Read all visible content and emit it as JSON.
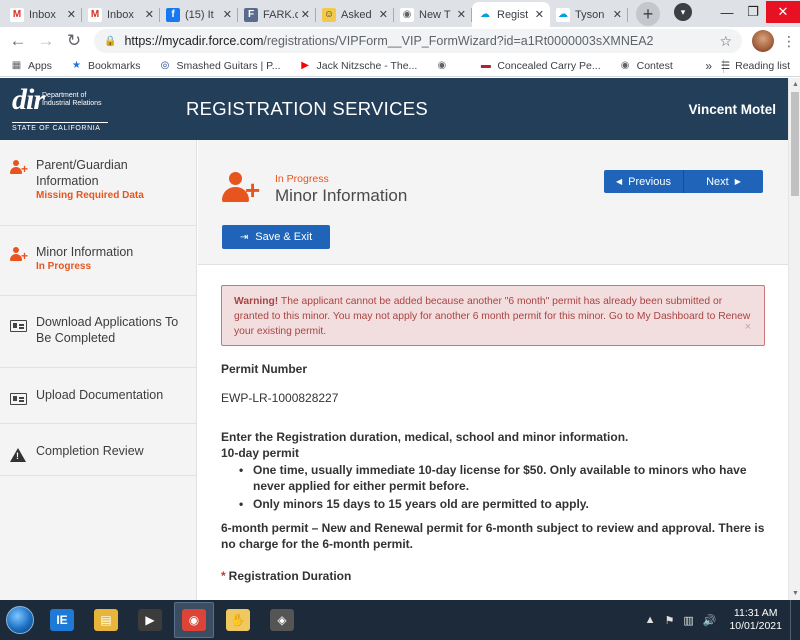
{
  "browser": {
    "tabs": [
      {
        "title": "Inbox",
        "icon": "M",
        "icon_color": "#d93025",
        "icon_bg": "#ffffff",
        "active": false
      },
      {
        "title": "Inbox",
        "icon": "M",
        "icon_color": "#d93025",
        "icon_bg": "#ffffff",
        "active": false
      },
      {
        "title": "(15) It",
        "icon": "f",
        "icon_color": "#ffffff",
        "icon_bg": "#1877f2",
        "active": false
      },
      {
        "title": "FARK.c",
        "icon": "F",
        "icon_color": "#ffffff",
        "icon_bg": "#5b6b8c",
        "active": false
      },
      {
        "title": "Asked",
        "icon": "☺",
        "icon_color": "#333333",
        "icon_bg": "#f2c94c",
        "active": false
      },
      {
        "title": "New T",
        "icon": "◉",
        "icon_color": "#5f6368",
        "icon_bg": "#ffffff",
        "active": false
      },
      {
        "title": "Regist",
        "icon": "☁",
        "icon_color": "#00a1e0",
        "icon_bg": "#ffffff",
        "active": true
      },
      {
        "title": "Tyson",
        "icon": "☁",
        "icon_color": "#00a1e0",
        "icon_bg": "#ffffff",
        "active": false
      }
    ],
    "tab_close": "✕",
    "new_tab": "+",
    "window_controls": {
      "minimize": "—",
      "maximize": "❐",
      "close": "✕"
    },
    "url_host": "https://mycadir.force.com",
    "url_path": "/registrations/VIPForm__VIP_FormWizard?id=a1Rt0000003sXMNEA2",
    "bookmarks": [
      {
        "label": "Apps",
        "icon": "▦",
        "icon_color": "#5f6368"
      },
      {
        "label": "Bookmarks",
        "icon": "★",
        "icon_color": "#1a73e8"
      },
      {
        "label": "Smashed Guitars | P...",
        "icon": "◎",
        "icon_color": "#1a3c8e"
      },
      {
        "label": "Jack Nitzsche - The...",
        "icon": "▶",
        "icon_color": "#ff0000"
      },
      {
        "label": "",
        "icon": "◉",
        "icon_color": "#5f6368"
      },
      {
        "label": "Concealed Carry Pe...",
        "icon": "▬",
        "icon_color": "#b22234"
      },
      {
        "label": "Contest",
        "icon": "◉",
        "icon_color": "#5f6368"
      }
    ],
    "bookmarks_more": "»",
    "reading_list": "Reading list"
  },
  "header": {
    "logo_big": "dir",
    "logo_dept": "Department of Industrial Relations",
    "logo_state": "STATE OF CALIFORNIA",
    "title": "REGISTRATION SERVICES",
    "user": "Vincent Motel"
  },
  "sidebar": {
    "steps": [
      {
        "label": "Parent/Guardian Information",
        "status": "Missing Required Data",
        "icon": "person-plus",
        "height": 86
      },
      {
        "label": "Minor Information",
        "status": "In Progress",
        "icon": "person-plus",
        "height": 70
      },
      {
        "label": "Download Applications To Be Completed",
        "status": "",
        "icon": "card",
        "height": 72
      },
      {
        "label": "Upload Documentation",
        "status": "",
        "icon": "card",
        "height": 56
      },
      {
        "label": "Completion Review",
        "status": "",
        "icon": "warning",
        "height": 52
      }
    ]
  },
  "main": {
    "status": "In Progress",
    "title": "Minor Information",
    "previous": "Previous",
    "next": "Next",
    "save_exit": "Save & Exit",
    "alert": {
      "heading": "Warning!",
      "text": "The applicant cannot be added because another \"6 month\" permit has already been submitted or granted to this minor. You may not apply for another 6 month permit for this minor. Go to My Dashboard to Renew your existing permit.",
      "close": "×"
    },
    "permit_label": "Permit Number",
    "permit_number": "EWP-LR-1000828227",
    "intro": "Enter the Registration duration, medical, school and minor information.",
    "ten_day_title": "10-day permit",
    "ten_day_items": [
      "One time, usually immediate 10-day license for $50.  Only available to minors who have never applied for either permit before.",
      "Only minors 15 days to 15 years old are permitted to apply."
    ],
    "six_month": "6-month permit – New and Renewal permit for 6-month subject to review and approval. There is no charge for the 6-month permit.",
    "required_mark": "*",
    "registration_duration": "Registration Duration"
  },
  "taskbar": {
    "apps": [
      {
        "icon": "IE",
        "color": "#1e7ad6"
      },
      {
        "icon": "▤",
        "color": "#e6b53a"
      },
      {
        "icon": "▶",
        "color": "#3c3c3c"
      },
      {
        "icon": "◉",
        "color": "#db4437"
      },
      {
        "icon": "✋",
        "color": "#f0c860"
      },
      {
        "icon": "◈",
        "color": "#555555"
      }
    ],
    "time": "11:31 AM",
    "date": "10/01/2021"
  }
}
